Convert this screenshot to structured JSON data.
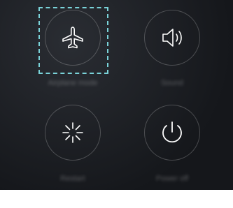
{
  "power_menu": {
    "airplane": {
      "label": "Airplane mode",
      "icon": "airplane-icon"
    },
    "sound": {
      "label": "Sound",
      "icon": "speaker-icon"
    },
    "restart": {
      "label": "Restart",
      "icon": "restart-icon"
    },
    "power_off": {
      "label": "Power off",
      "icon": "power-icon"
    }
  },
  "colors": {
    "focus_highlight": "#7ad3d9",
    "icon": "#ffffff"
  }
}
